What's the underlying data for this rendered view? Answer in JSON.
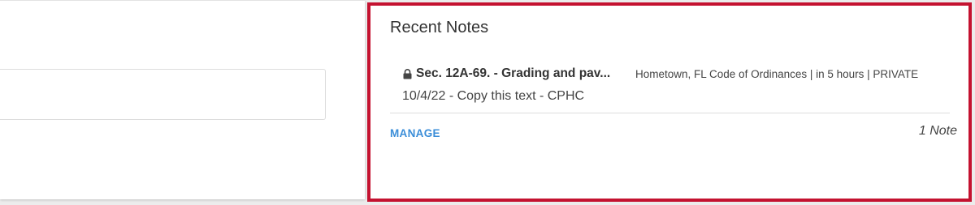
{
  "recent_notes": {
    "title": "Recent Notes",
    "notes": [
      {
        "lock_icon": "lock-icon",
        "title": "Sec. 12A-69. - Grading and pav...",
        "meta": "Hometown, FL Code of Ordinances | in 5 hours | PRIVATE",
        "body": "10/4/22 - Copy this text - CPHC"
      }
    ],
    "manage_label": "MANAGE",
    "count_label": "1 Note"
  },
  "colors": {
    "highlight_border": "#c41230",
    "link": "#3a8dd8"
  }
}
